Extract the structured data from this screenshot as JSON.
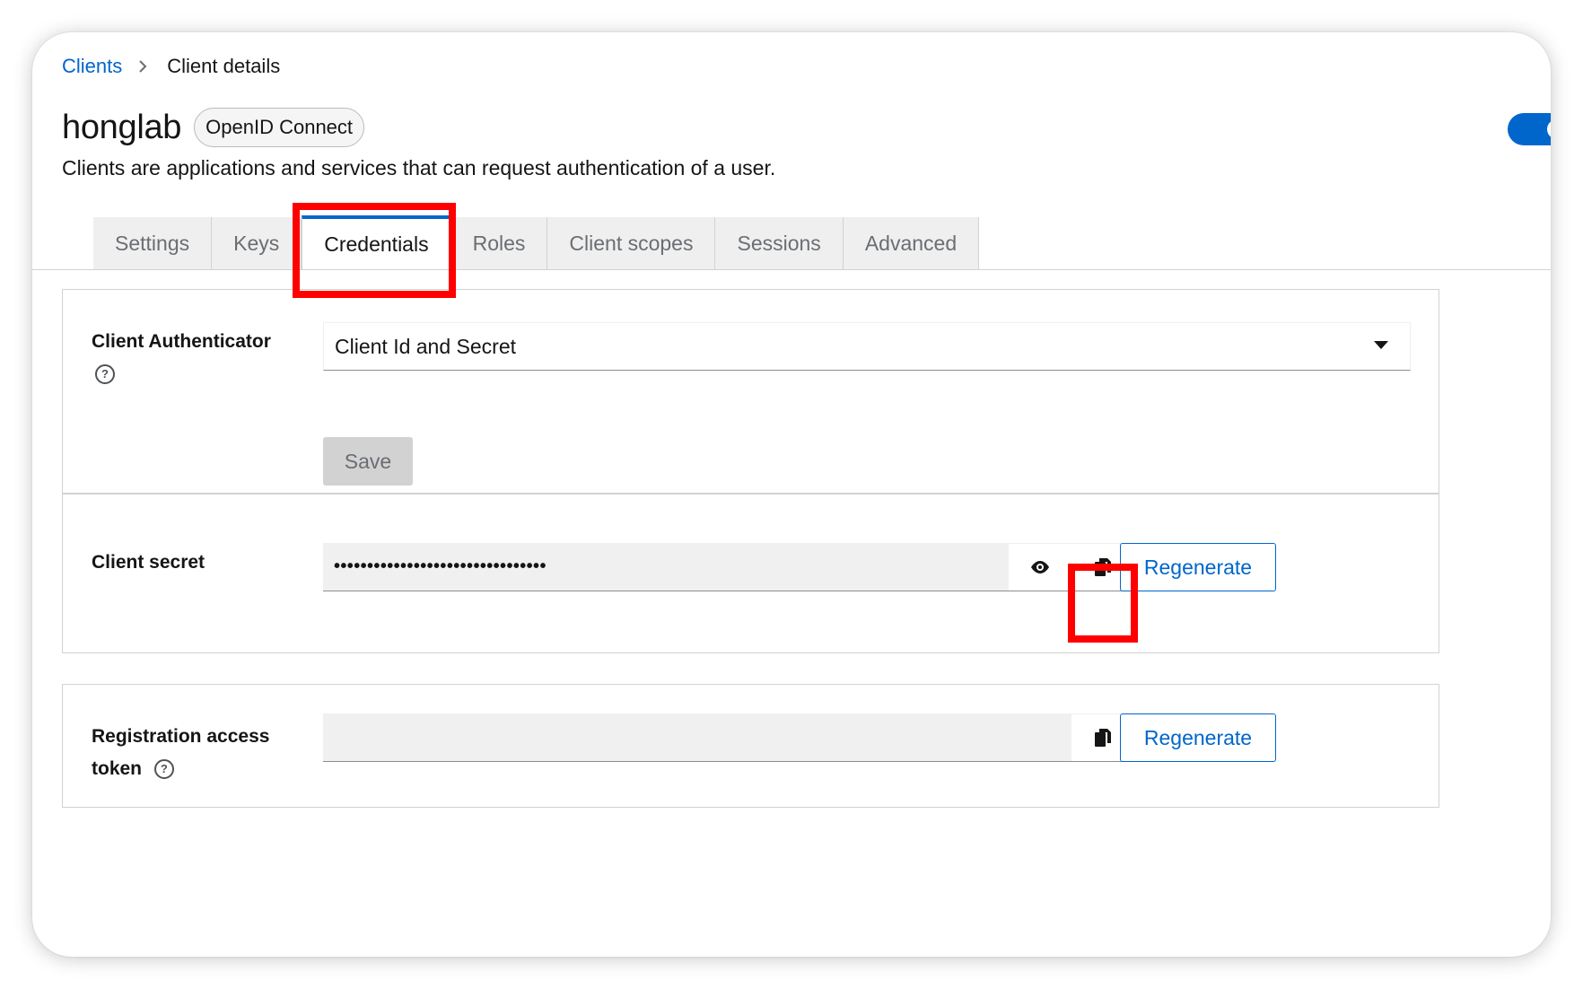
{
  "breadcrumb": {
    "parent": "Clients",
    "current": "Client details"
  },
  "header": {
    "title": "honglab",
    "protocol_badge": "OpenID Connect",
    "description": "Clients are applications and services that can request authentication of a user."
  },
  "tabs": [
    {
      "label": "Settings",
      "active": false
    },
    {
      "label": "Keys",
      "active": false
    },
    {
      "label": "Credentials",
      "active": true
    },
    {
      "label": "Roles",
      "active": false
    },
    {
      "label": "Client scopes",
      "active": false
    },
    {
      "label": "Sessions",
      "active": false
    },
    {
      "label": "Advanced",
      "active": false
    }
  ],
  "authenticator": {
    "label": "Client Authenticator",
    "selected_value": "Client Id and Secret",
    "save_label": "Save"
  },
  "client_secret": {
    "label": "Client secret",
    "masked_value": "••••••••••••••••••••••••••••••••",
    "regenerate_label": "Regenerate"
  },
  "registration_token": {
    "label_line1": "Registration access",
    "label_line2": "token",
    "value": "",
    "regenerate_label": "Regenerate"
  },
  "colors": {
    "accent": "#0066cc",
    "highlight": "#ff0000"
  }
}
